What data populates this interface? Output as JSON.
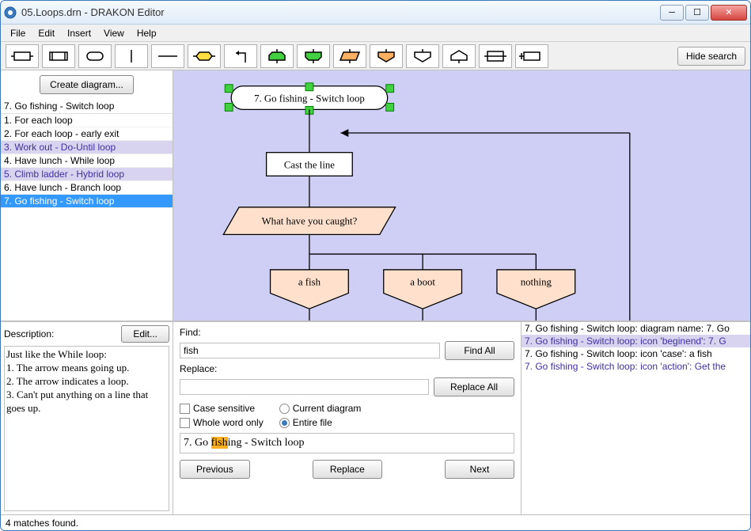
{
  "window": {
    "title": "05.Loops.drn - DRAKON Editor"
  },
  "menubar": [
    "File",
    "Edit",
    "Insert",
    "View",
    "Help"
  ],
  "toolbar": {
    "hide_search": "Hide search"
  },
  "sidebar": {
    "create_btn": "Create diagram...",
    "header": "7. Go fishing - Switch loop",
    "items": [
      {
        "label": "1. For each loop",
        "state": "normal"
      },
      {
        "label": "2. For each loop - early exit",
        "state": "normal"
      },
      {
        "label": "3. Work out - Do-Until loop",
        "state": "highlighted"
      },
      {
        "label": "4. Have lunch - While loop",
        "state": "normal"
      },
      {
        "label": "5. Climb ladder - Hybrid loop",
        "state": "highlighted"
      },
      {
        "label": "6. Have lunch - Branch loop",
        "state": "normal"
      },
      {
        "label": "7. Go fishing - Switch loop",
        "state": "selected"
      }
    ]
  },
  "canvas": {
    "title": "7. Go fishing - Switch loop",
    "nodes": {
      "action": "Cast the line",
      "question": "What have you caught?",
      "cases": [
        "a fish",
        "a boot",
        "nothing"
      ]
    }
  },
  "description": {
    "label": "Description:",
    "edit_btn": "Edit...",
    "text": "Just like the While loop:\n1. The arrow means going up.\n2. The arrow indicates a loop.\n3. Can't put anything on a line that goes up."
  },
  "search": {
    "find_label": "Find:",
    "find_value": "fish",
    "find_all": "Find All",
    "replace_label": "Replace:",
    "replace_value": "",
    "replace_all": "Replace All",
    "case_sensitive": "Case sensitive",
    "whole_word": "Whole word only",
    "current_diagram": "Current diagram",
    "entire_file": "Entire file",
    "scope": "entire_file",
    "current_match_prefix": "7. Go ",
    "current_match_hl": "fish",
    "current_match_suffix": "ing - Switch loop",
    "prev": "Previous",
    "replace": "Replace",
    "next": "Next"
  },
  "results": [
    {
      "text": "7. Go fishing - Switch loop: diagram name: 7. Go",
      "alt": false
    },
    {
      "text": "7. Go fishing - Switch loop: icon 'beginend': 7. G",
      "alt": true,
      "sel": true
    },
    {
      "text": "7. Go fishing - Switch loop: icon 'case': a fish",
      "alt": false
    },
    {
      "text": "7. Go fishing - Switch loop: icon 'action': Get the",
      "alt": true
    }
  ],
  "statusbar": "4 matches found."
}
